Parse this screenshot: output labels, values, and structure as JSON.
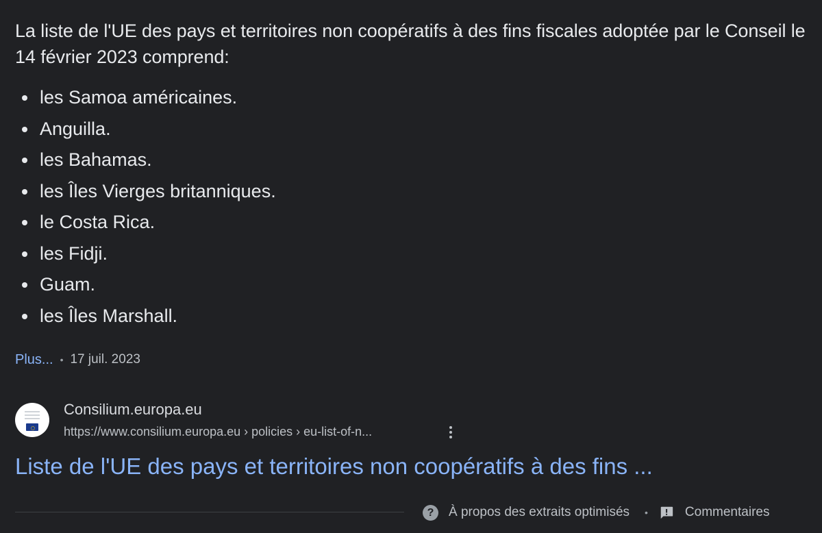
{
  "snippet": {
    "intro": "La liste de l'UE des pays et territoires non coopératifs à des fins fiscales adoptée par le Conseil le 14 février 2023 comprend:",
    "items": [
      "les Samoa américaines.",
      "Anguilla.",
      "les Bahamas.",
      "les Îles Vierges britanniques.",
      "le Costa Rica.",
      "les Fidji.",
      "Guam.",
      "les Îles Marshall."
    ],
    "more_label": "Plus...",
    "separator": "•",
    "date": "17 juil. 2023"
  },
  "source": {
    "favicon": "eu-council-favicon",
    "site_name": "Consilium.europa.eu",
    "url": "https://www.consilium.europa.eu › policies › eu-list-of-n...",
    "menu_icon": "more-vert-icon"
  },
  "result": {
    "title": "Liste de l'UE des pays et territoires non coopératifs à des fins ..."
  },
  "footer": {
    "about_label": "À propos des extraits optimisés",
    "separator": "•",
    "feedback_label": "Commentaires",
    "about_icon": "help-icon",
    "feedback_icon": "feedback-icon"
  },
  "colors": {
    "background": "#202124",
    "text": "#e8eaed",
    "link": "#8ab4f8",
    "muted": "#bdc1c6"
  }
}
